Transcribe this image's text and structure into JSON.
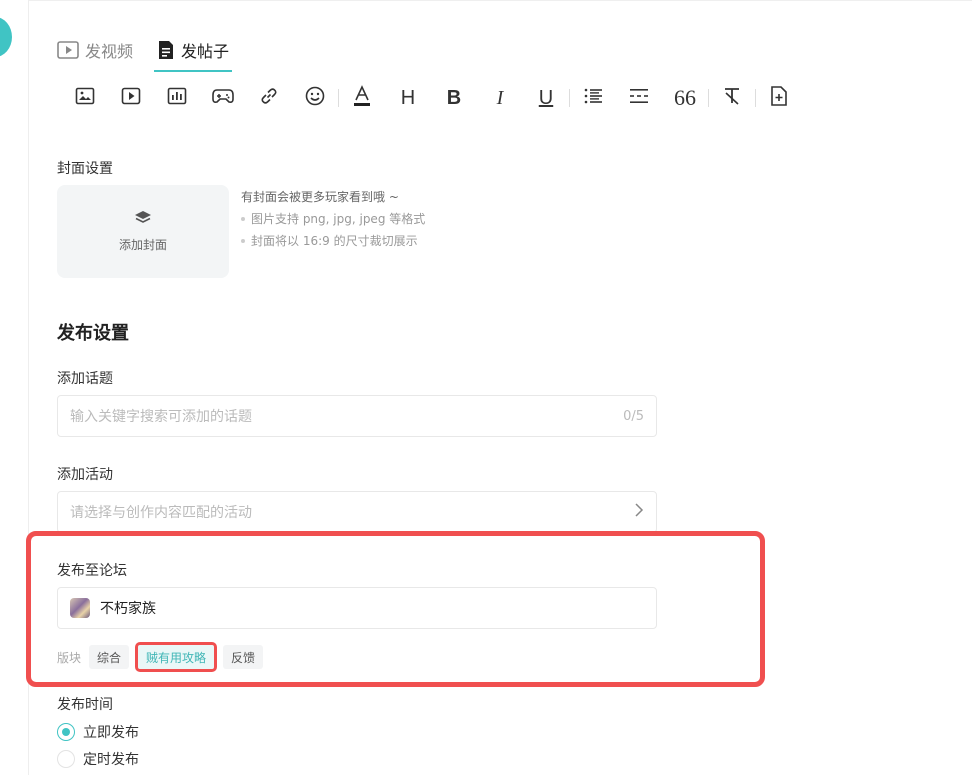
{
  "tabs": [
    {
      "label": "发视频",
      "icon": "play-square-icon",
      "active": false
    },
    {
      "label": "发帖子",
      "icon": "document-icon",
      "active": true
    }
  ],
  "toolbar": {
    "heading_glyph": "H",
    "bold_glyph": "B",
    "italic_glyph": "I",
    "underline_glyph": "U",
    "quote_glyph": "66"
  },
  "cover": {
    "label": "封面设置",
    "add_label": "添加封面",
    "tip_main": "有封面会被更多玩家看到哦 ~",
    "tip_1": "图片支持 png, jpg, jpeg 等格式",
    "tip_2": "封面将以 16:9 的尺寸裁切展示"
  },
  "publish": {
    "title": "发布设置",
    "topic_label": "添加话题",
    "topic_placeholder": "输入关键字搜索可添加的话题",
    "topic_count": "0/5",
    "activity_label": "添加活动",
    "activity_placeholder": "请选择与创作内容匹配的活动",
    "forum_label": "发布至论坛",
    "forum_value": "不朽家族",
    "board_label": "版块",
    "boards": [
      "综合",
      "贼有用攻略",
      "反馈"
    ],
    "active_board": "贼有用攻略",
    "time_label": "发布时间",
    "time_now": "立即发布",
    "time_scheduled": "定时发布"
  },
  "colors": {
    "accent": "#40c4c4",
    "highlight": "#f04f4f"
  }
}
